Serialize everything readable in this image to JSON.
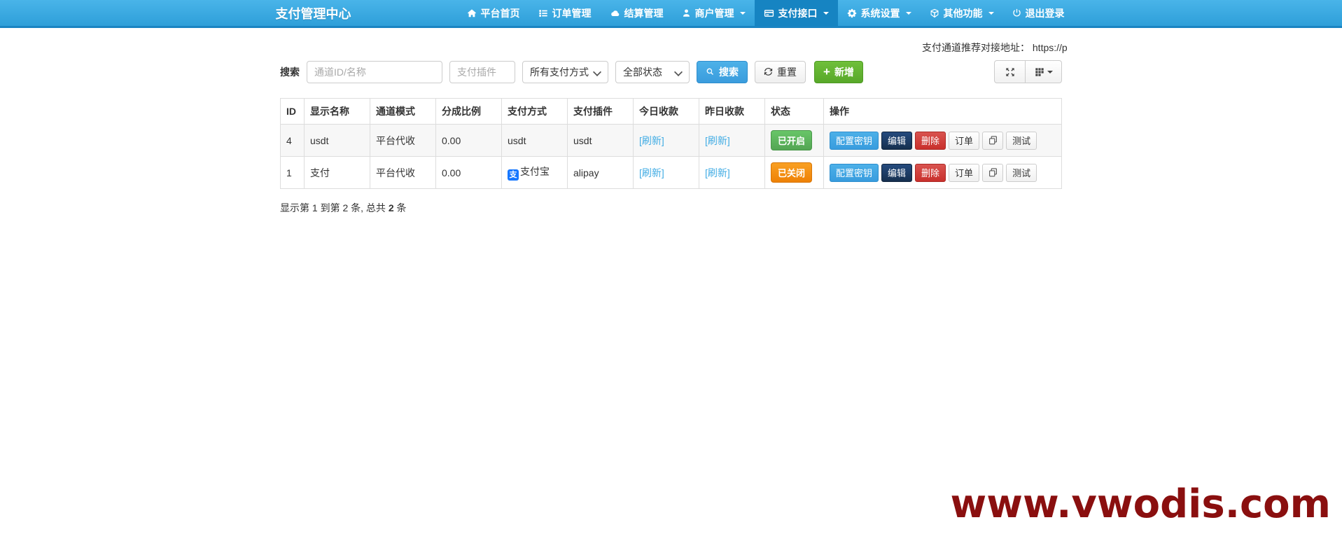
{
  "navbar": {
    "brand": "支付管理中心",
    "items": [
      {
        "label": "平台首页",
        "icon": "home-icon",
        "caret": false,
        "active": false
      },
      {
        "label": "订单管理",
        "icon": "list-icon",
        "caret": false,
        "active": false
      },
      {
        "label": "结算管理",
        "icon": "cloud-icon",
        "caret": false,
        "active": false
      },
      {
        "label": "商户管理",
        "icon": "user-icon",
        "caret": true,
        "active": false
      },
      {
        "label": "支付接口",
        "icon": "credit-card-icon",
        "caret": true,
        "active": true
      },
      {
        "label": "系统设置",
        "icon": "gear-icon",
        "caret": true,
        "active": false
      },
      {
        "label": "其他功能",
        "icon": "cube-icon",
        "caret": true,
        "active": false
      },
      {
        "label": "退出登录",
        "icon": "power-icon",
        "caret": false,
        "active": false
      }
    ]
  },
  "recommend_bar": {
    "label": "支付通道推荐对接地址：",
    "url": "https://p"
  },
  "search": {
    "label": "搜索",
    "channel_placeholder": "通道ID/名称",
    "plugin_placeholder": "支付插件",
    "method_selected": "所有支付方式",
    "status_selected": "全部状态",
    "search_button": "搜索",
    "reset_button": "重置",
    "add_button": "新增"
  },
  "table": {
    "headers": [
      "ID",
      "显示名称",
      "通道模式",
      "分成比例",
      "支付方式",
      "支付插件",
      "今日收款",
      "昨日收款",
      "状态",
      "操作"
    ],
    "refresh_link": "[刷新]",
    "actions": {
      "configure_key": "配置密钥",
      "edit": "编辑",
      "delete": "删除",
      "order": "订单",
      "test": "测试"
    },
    "rows": [
      {
        "id": "4",
        "name": "usdt",
        "mode": "平台代收",
        "ratio": "0.00",
        "method": "usdt",
        "method_icon": null,
        "plugin": "usdt",
        "status": "已开启",
        "status_type": "open"
      },
      {
        "id": "1",
        "name": "支付",
        "mode": "平台代收",
        "ratio": "0.00",
        "method": "支付宝",
        "method_icon": "alipay",
        "plugin": "alipay",
        "status": "已关闭",
        "status_type": "closed"
      }
    ]
  },
  "pagination": {
    "prefix": "显示第 1 到第 2 条, 总共 ",
    "total": "2",
    "suffix": " 条"
  },
  "watermark": "www.vwodis.com",
  "alipay_icon_char": "支",
  "colors": {
    "navbar_top": "#49b4e9",
    "navbar_bottom": "#2e9fd9",
    "navbar_active": "#1684c2",
    "primary_blue": "#3a9cdd",
    "add_green": "#58a829",
    "status_open_green": "#53a553",
    "status_closed_orange": "#ee8106",
    "edit_navy": "#16304f",
    "delete_red": "#c9302c",
    "refresh_link_blue": "#41ace4",
    "alipay_blue": "#1677ff",
    "watermark_red": "#8a0f0f"
  }
}
